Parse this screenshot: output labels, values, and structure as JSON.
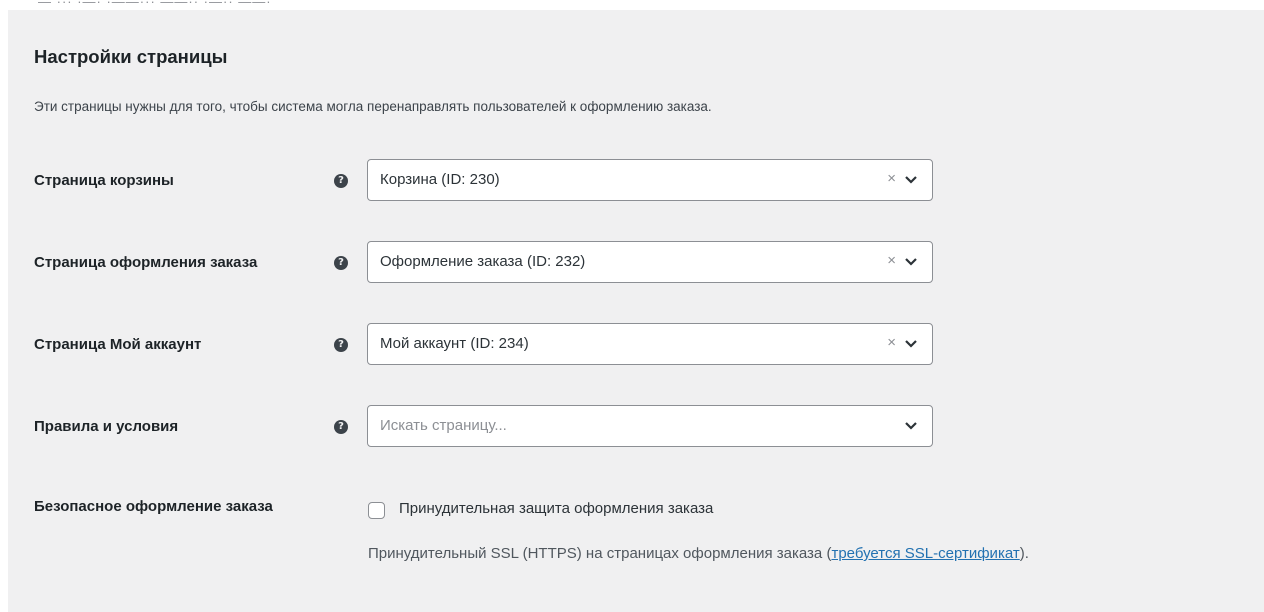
{
  "top_cut_text": "— ··· ·—· ·——··· ——·· ·—·· ——·",
  "section": {
    "title": "Настройки страницы",
    "description": "Эти страницы нужны для того, чтобы система могла перенаправлять пользователей к оформлению заказа."
  },
  "rows": [
    {
      "label": "Страница корзины",
      "value": "Корзина (ID: 230)",
      "clear": "×"
    },
    {
      "label": "Страница оформления заказа",
      "value": "Оформление заказа (ID: 232)",
      "clear": "×"
    },
    {
      "label": "Страница Мой аккаунт",
      "value": "Мой аккаунт (ID: 234)",
      "clear": "×"
    },
    {
      "label": "Правила и условия",
      "placeholder": "Искать страницу..."
    }
  ],
  "help_glyph": "?",
  "secure": {
    "label": "Безопасное оформление заказа",
    "checkbox_label": "Принудительная защита оформления заказа",
    "checked": false,
    "desc_prefix": "Принудительный SSL (HTTPS) на страницах оформления заказа (",
    "desc_link": "требуется SSL-сертификат",
    "desc_suffix": ")."
  }
}
